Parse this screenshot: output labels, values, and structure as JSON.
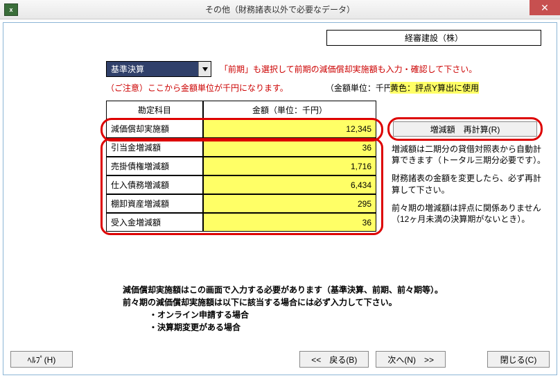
{
  "window": {
    "icon_text": "x",
    "title": "その他（財務諸表以外で必要なデータ）",
    "close": "✕"
  },
  "company": "経審建設（株）",
  "period": {
    "selected": "基準決算",
    "note": "「前期」も選択して前期の減価償却実施額も入力・確認して下さい。"
  },
  "caution": {
    "label": "（ご注意）ここから金額単位が千円になります。",
    "unit": "（金額単位：千円）"
  },
  "yellow_note": "黄色：評点Y算出に使用",
  "table": {
    "headers": {
      "c1": "勘定科目",
      "c2": "金額（単位：千円）"
    },
    "rows": [
      {
        "label": "減価償却実施額",
        "value": "12,345"
      },
      {
        "label": "引当金増減額",
        "value": "36"
      },
      {
        "label": "売掛債権増減額",
        "value": "1,716"
      },
      {
        "label": "仕入債務増減額",
        "value": "6,434"
      },
      {
        "label": "棚卸資産増減額",
        "value": "295"
      },
      {
        "label": "受入金増減額",
        "value": "36"
      }
    ]
  },
  "recalc_label": "増減額　再計算(R)",
  "right_text": {
    "p1": "増減額は二期分の貸借対照表から自動計算できます（トータル三期分必要です）。",
    "p2": "財務諸表の金額を変更したら、必ず再計算して下さい。",
    "p3": "前々期の増減額は評点に関係ありません（12ヶ月未満の決算期がないとき）。"
  },
  "bottom_text": {
    "l1": "減価償却実施額はこの画面で入力する必要があります（基準決算、前期、前々期等）。",
    "l2": "前々期の減価償却実施額は以下に該当する場合には必ず入力して下さい。",
    "b1": "・オンライン申請する場合",
    "b2": "・決算期変更がある場合"
  },
  "buttons": {
    "help": "ﾍﾙﾌﾟ(H)",
    "back": "<<　戻る(B)",
    "next": "次へ(N)　>>",
    "close": "閉じる(C)"
  }
}
